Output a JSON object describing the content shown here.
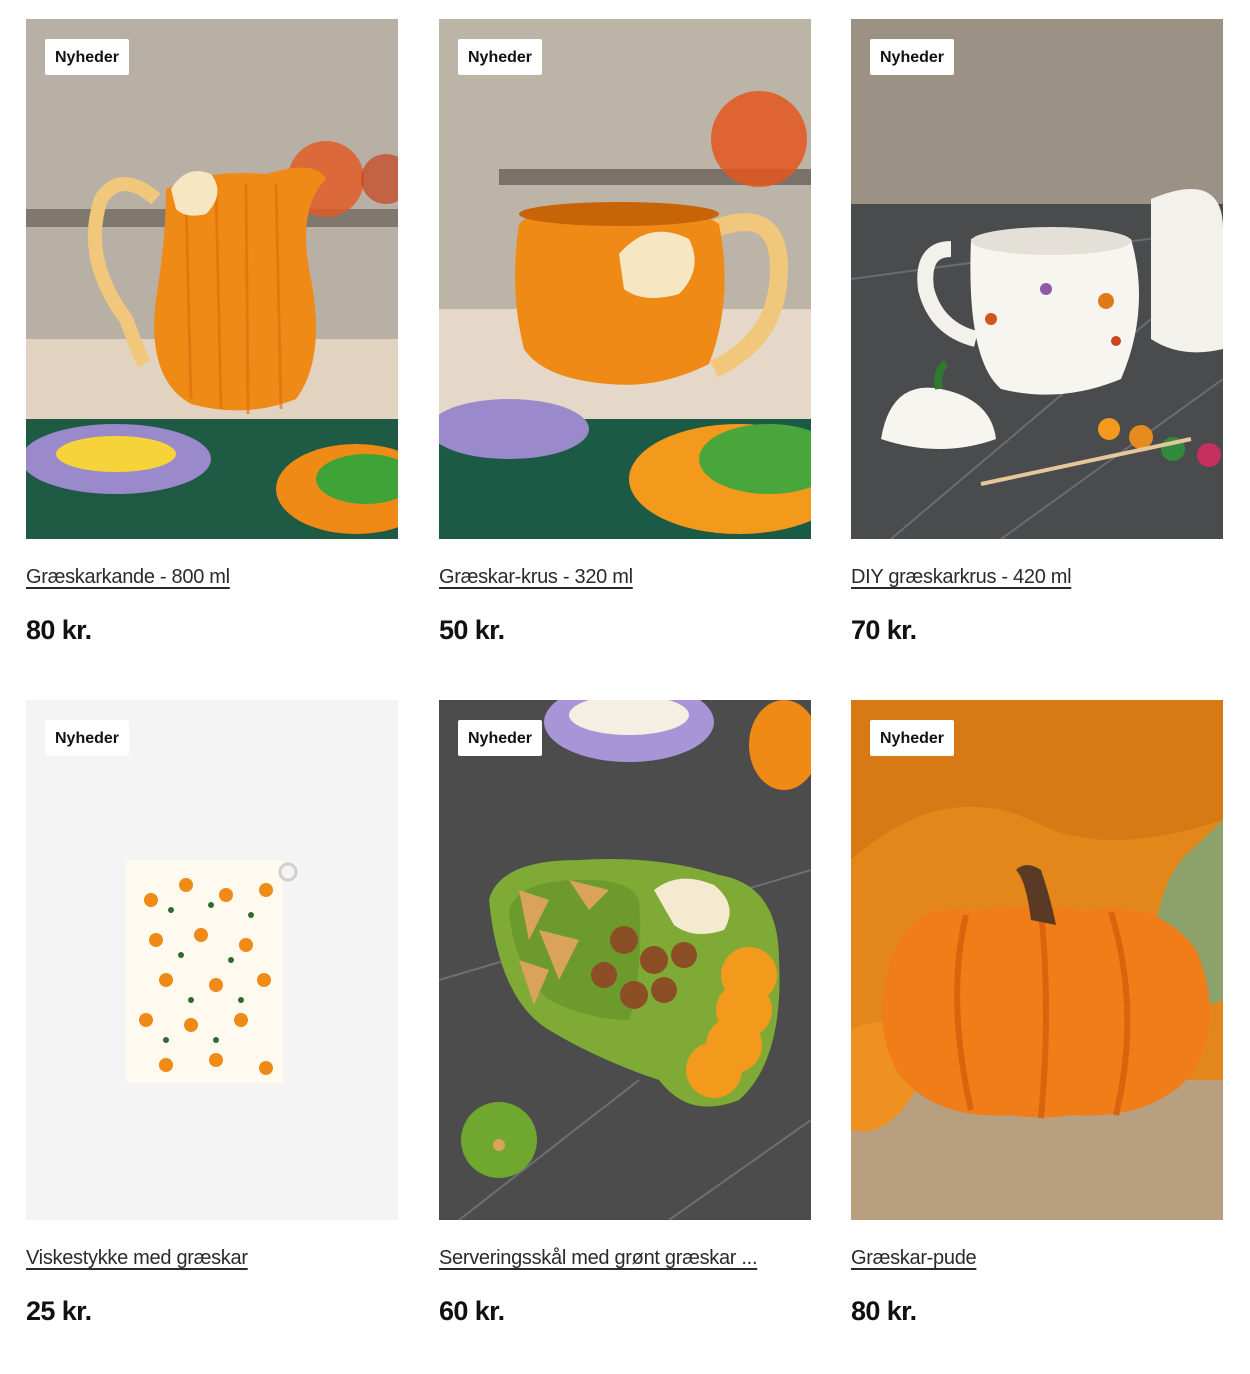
{
  "products": [
    {
      "badge": "Nyheder",
      "title": "Græskarkande - 800 ml",
      "price": "80 kr.",
      "image_desc": "pumpkin-jug"
    },
    {
      "badge": "Nyheder",
      "title": "Græskar-krus - 320 ml",
      "price": "50 kr.",
      "image_desc": "pumpkin-mug"
    },
    {
      "badge": "Nyheder",
      "title": "DIY græskarkrus - 420 ml",
      "price": "70 kr.",
      "image_desc": "diy-mug"
    },
    {
      "badge": "Nyheder",
      "title": "Viskestykke med græskar",
      "price": "25 kr.",
      "image_desc": "tea-towel"
    },
    {
      "badge": "Nyheder",
      "title": "Serveringsskål med grønt græskar ...",
      "price": "60 kr.",
      "image_desc": "serving-bowl"
    },
    {
      "badge": "Nyheder",
      "title": "Græskar-pude",
      "price": "80 kr.",
      "image_desc": "pumpkin-pillow"
    }
  ],
  "colors": {
    "accent_orange": "#f08a16",
    "text": "#1a1a1a",
    "badge_bg": "#ffffff"
  }
}
